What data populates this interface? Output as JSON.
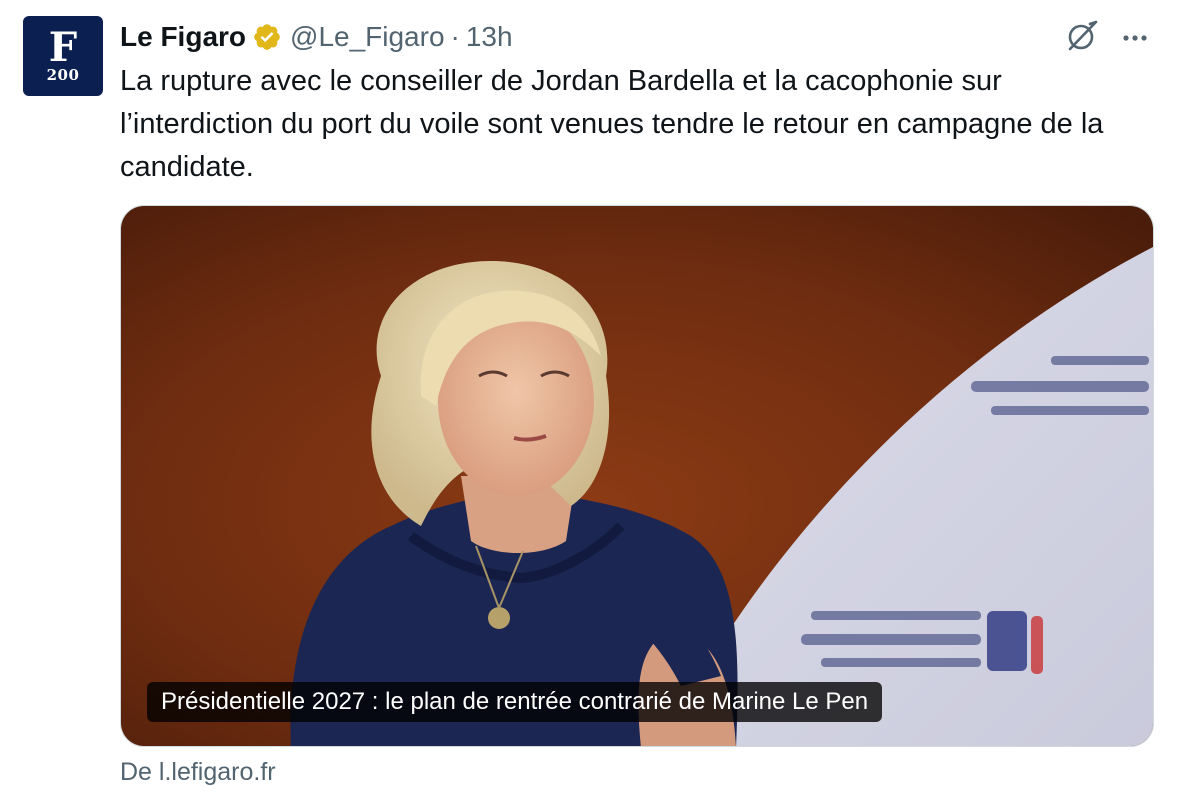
{
  "author": {
    "name": "Le Figaro",
    "handle": "@Le_Figaro",
    "separator": "·",
    "time": "13h",
    "avatar_letter": "F",
    "avatar_badge": "200",
    "verified_icon": "verified-badge-gold"
  },
  "tweet": {
    "text": "La rupture avec le conseiller de Jordan Bardella et la cacophonie sur l’interdiction du port du voile sont venues tendre le retour en campagne de la candidate."
  },
  "card": {
    "caption": "Présidentielle 2027 : le plan de rentrée contrarié de Marine Le Pen",
    "source": "De l.lefigaro.fr",
    "image_description_icon": "photo"
  },
  "icons": {
    "grok": "grok-icon",
    "more": "more-icon"
  },
  "colors": {
    "text": "#0f1419",
    "secondary": "#536471",
    "verified_gold": "#e2b719",
    "avatar_bg": "#0b2050"
  }
}
